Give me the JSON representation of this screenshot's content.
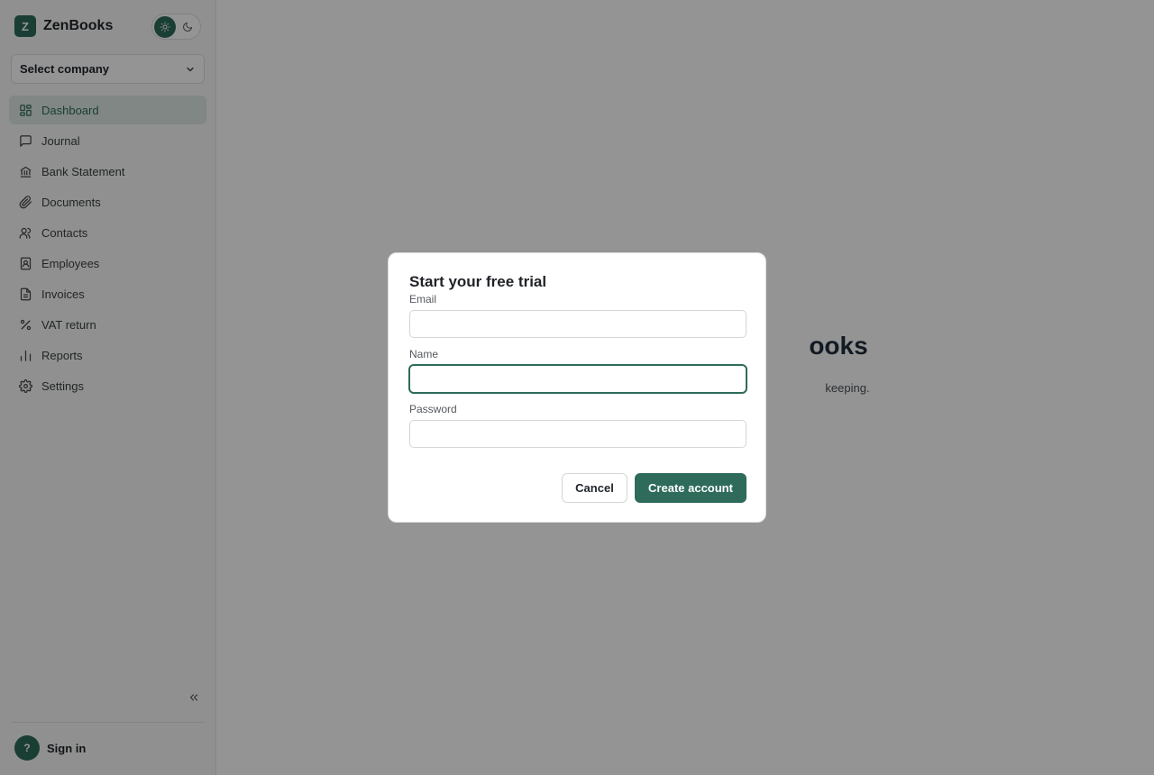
{
  "app": {
    "logo_letter": "Z",
    "name": "ZenBooks"
  },
  "theme": {
    "light_icon": "sun-icon",
    "dark_icon": "moon-icon",
    "selected": "light"
  },
  "company_select": {
    "label": "Select company",
    "icon": "chevron-down-icon"
  },
  "sidebar": {
    "items": [
      {
        "label": "Dashboard",
        "icon": "dashboard-icon",
        "active": true
      },
      {
        "label": "Journal",
        "icon": "message-square-icon"
      },
      {
        "label": "Bank Statement",
        "icon": "bank-icon"
      },
      {
        "label": "Documents",
        "icon": "paperclip-icon"
      },
      {
        "label": "Contacts",
        "icon": "users-icon"
      },
      {
        "label": "Employees",
        "icon": "id-badge-icon"
      },
      {
        "label": "Invoices",
        "icon": "file-text-icon"
      },
      {
        "label": "VAT return",
        "icon": "percent-icon"
      },
      {
        "label": "Reports",
        "icon": "bar-chart-icon"
      },
      {
        "label": "Settings",
        "icon": "gear-icon"
      }
    ],
    "collapse_icon": "chevrons-left-icon",
    "signin": {
      "avatar": "?",
      "label": "Sign in"
    }
  },
  "main": {
    "welcome_title_visible": "ooks",
    "welcome_subtitle_visible": "keeping."
  },
  "modal": {
    "title": "Start your free trial",
    "fields": [
      {
        "label": "Email",
        "value": "",
        "placeholder": ""
      },
      {
        "label": "Name",
        "value": "",
        "placeholder": "",
        "focused": true
      },
      {
        "label": "Password",
        "value": "",
        "placeholder": ""
      }
    ],
    "cancel_label": "Cancel",
    "submit_label": "Create account"
  },
  "colors": {
    "accent": "#2e6b5a",
    "overlay": "rgba(0,0,0,0.42)"
  }
}
